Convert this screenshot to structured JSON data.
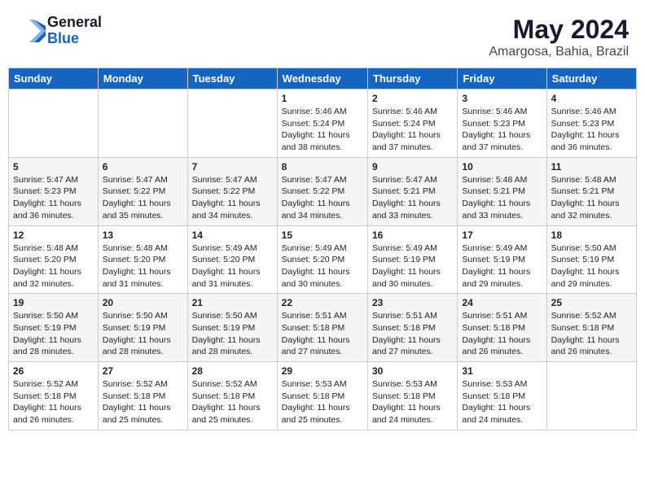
{
  "header": {
    "logo_general": "General",
    "logo_blue": "Blue",
    "month": "May 2024",
    "location": "Amargosa, Bahia, Brazil"
  },
  "days_of_week": [
    "Sunday",
    "Monday",
    "Tuesday",
    "Wednesday",
    "Thursday",
    "Friday",
    "Saturday"
  ],
  "weeks": [
    [
      {
        "day": "",
        "info": ""
      },
      {
        "day": "",
        "info": ""
      },
      {
        "day": "",
        "info": ""
      },
      {
        "day": "1",
        "info": "Sunrise: 5:46 AM\nSunset: 5:24 PM\nDaylight: 11 hours and 38 minutes."
      },
      {
        "day": "2",
        "info": "Sunrise: 5:46 AM\nSunset: 5:24 PM\nDaylight: 11 hours and 37 minutes."
      },
      {
        "day": "3",
        "info": "Sunrise: 5:46 AM\nSunset: 5:23 PM\nDaylight: 11 hours and 37 minutes."
      },
      {
        "day": "4",
        "info": "Sunrise: 5:46 AM\nSunset: 5:23 PM\nDaylight: 11 hours and 36 minutes."
      }
    ],
    [
      {
        "day": "5",
        "info": "Sunrise: 5:47 AM\nSunset: 5:23 PM\nDaylight: 11 hours and 36 minutes."
      },
      {
        "day": "6",
        "info": "Sunrise: 5:47 AM\nSunset: 5:22 PM\nDaylight: 11 hours and 35 minutes."
      },
      {
        "day": "7",
        "info": "Sunrise: 5:47 AM\nSunset: 5:22 PM\nDaylight: 11 hours and 34 minutes."
      },
      {
        "day": "8",
        "info": "Sunrise: 5:47 AM\nSunset: 5:22 PM\nDaylight: 11 hours and 34 minutes."
      },
      {
        "day": "9",
        "info": "Sunrise: 5:47 AM\nSunset: 5:21 PM\nDaylight: 11 hours and 33 minutes."
      },
      {
        "day": "10",
        "info": "Sunrise: 5:48 AM\nSunset: 5:21 PM\nDaylight: 11 hours and 33 minutes."
      },
      {
        "day": "11",
        "info": "Sunrise: 5:48 AM\nSunset: 5:21 PM\nDaylight: 11 hours and 32 minutes."
      }
    ],
    [
      {
        "day": "12",
        "info": "Sunrise: 5:48 AM\nSunset: 5:20 PM\nDaylight: 11 hours and 32 minutes."
      },
      {
        "day": "13",
        "info": "Sunrise: 5:48 AM\nSunset: 5:20 PM\nDaylight: 11 hours and 31 minutes."
      },
      {
        "day": "14",
        "info": "Sunrise: 5:49 AM\nSunset: 5:20 PM\nDaylight: 11 hours and 31 minutes."
      },
      {
        "day": "15",
        "info": "Sunrise: 5:49 AM\nSunset: 5:20 PM\nDaylight: 11 hours and 30 minutes."
      },
      {
        "day": "16",
        "info": "Sunrise: 5:49 AM\nSunset: 5:19 PM\nDaylight: 11 hours and 30 minutes."
      },
      {
        "day": "17",
        "info": "Sunrise: 5:49 AM\nSunset: 5:19 PM\nDaylight: 11 hours and 29 minutes."
      },
      {
        "day": "18",
        "info": "Sunrise: 5:50 AM\nSunset: 5:19 PM\nDaylight: 11 hours and 29 minutes."
      }
    ],
    [
      {
        "day": "19",
        "info": "Sunrise: 5:50 AM\nSunset: 5:19 PM\nDaylight: 11 hours and 28 minutes."
      },
      {
        "day": "20",
        "info": "Sunrise: 5:50 AM\nSunset: 5:19 PM\nDaylight: 11 hours and 28 minutes."
      },
      {
        "day": "21",
        "info": "Sunrise: 5:50 AM\nSunset: 5:19 PM\nDaylight: 11 hours and 28 minutes."
      },
      {
        "day": "22",
        "info": "Sunrise: 5:51 AM\nSunset: 5:18 PM\nDaylight: 11 hours and 27 minutes."
      },
      {
        "day": "23",
        "info": "Sunrise: 5:51 AM\nSunset: 5:18 PM\nDaylight: 11 hours and 27 minutes."
      },
      {
        "day": "24",
        "info": "Sunrise: 5:51 AM\nSunset: 5:18 PM\nDaylight: 11 hours and 26 minutes."
      },
      {
        "day": "25",
        "info": "Sunrise: 5:52 AM\nSunset: 5:18 PM\nDaylight: 11 hours and 26 minutes."
      }
    ],
    [
      {
        "day": "26",
        "info": "Sunrise: 5:52 AM\nSunset: 5:18 PM\nDaylight: 11 hours and 26 minutes."
      },
      {
        "day": "27",
        "info": "Sunrise: 5:52 AM\nSunset: 5:18 PM\nDaylight: 11 hours and 25 minutes."
      },
      {
        "day": "28",
        "info": "Sunrise: 5:52 AM\nSunset: 5:18 PM\nDaylight: 11 hours and 25 minutes."
      },
      {
        "day": "29",
        "info": "Sunrise: 5:53 AM\nSunset: 5:18 PM\nDaylight: 11 hours and 25 minutes."
      },
      {
        "day": "30",
        "info": "Sunrise: 5:53 AM\nSunset: 5:18 PM\nDaylight: 11 hours and 24 minutes."
      },
      {
        "day": "31",
        "info": "Sunrise: 5:53 AM\nSunset: 5:18 PM\nDaylight: 11 hours and 24 minutes."
      },
      {
        "day": "",
        "info": ""
      }
    ]
  ]
}
